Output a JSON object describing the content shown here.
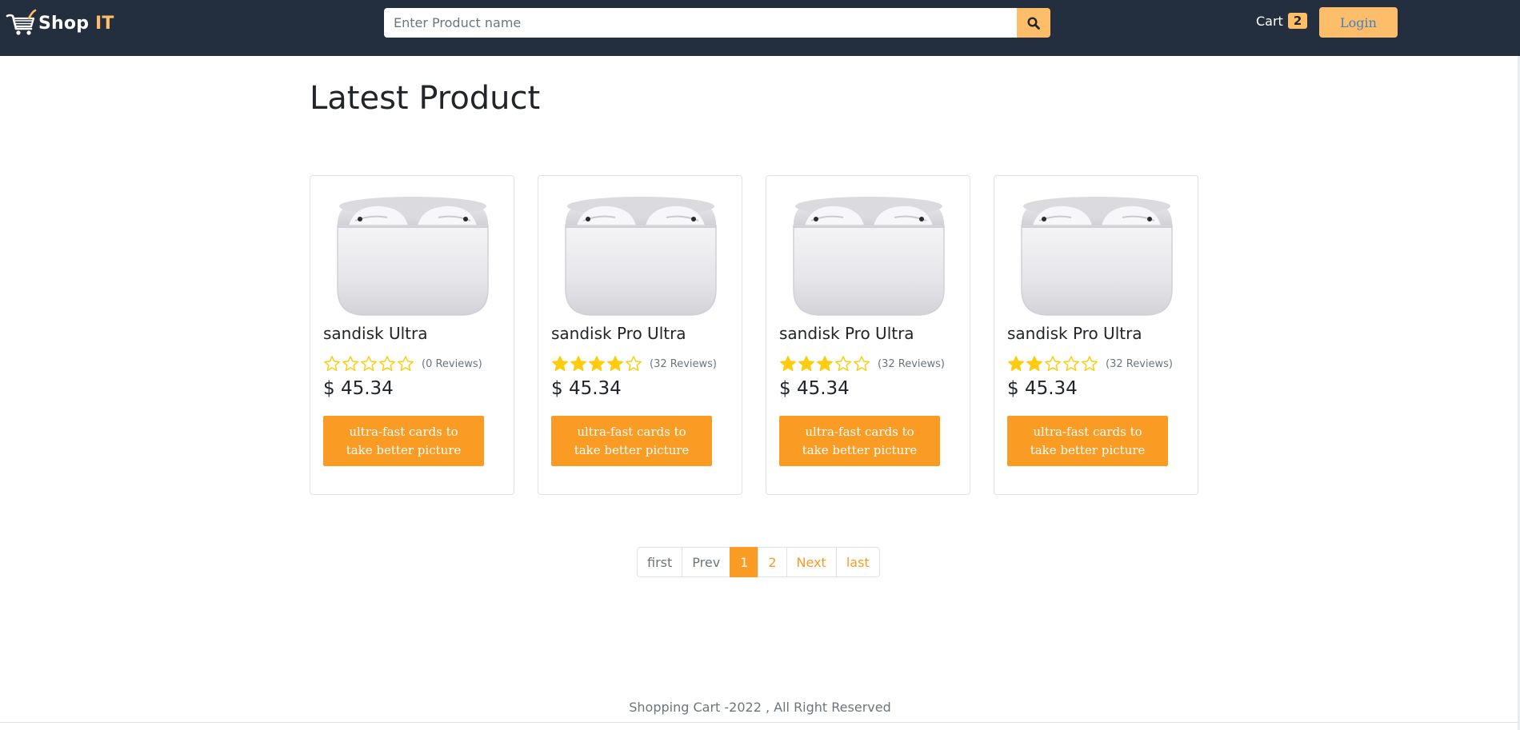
{
  "header": {
    "logo": {
      "brand": "Shop",
      "accent": "IT",
      "icon": "shopping-cart-icon"
    },
    "search": {
      "placeholder": "Enter Product name",
      "value": "",
      "button_icon": "search-icon"
    },
    "cart": {
      "label": "Cart",
      "count": "2"
    },
    "login_label": "Login"
  },
  "main": {
    "title": "Latest Product",
    "products": [
      {
        "name": "sandisk Ultra",
        "rating": 0,
        "reviews": "(0 Reviews)",
        "price": "$ 45.34",
        "button_label": "ultra-fast cards to take better picture"
      },
      {
        "name": "sandisk Pro Ultra",
        "rating": 4,
        "reviews": "(32 Reviews)",
        "price": "$ 45.34",
        "button_label": "ultra-fast cards to take better picture"
      },
      {
        "name": "sandisk Pro Ultra",
        "rating": 3,
        "reviews": "(32 Reviews)",
        "price": "$ 45.34",
        "button_label": "ultra-fast cards to take better picture"
      },
      {
        "name": "sandisk Pro Ultra",
        "rating": 2,
        "reviews": "(32 Reviews)",
        "price": "$ 45.34",
        "button_label": "ultra-fast cards to take better picture"
      }
    ],
    "rating_max": 5
  },
  "pagination": {
    "items": [
      {
        "label": "first",
        "state": "muted"
      },
      {
        "label": "Prev",
        "state": "muted"
      },
      {
        "label": "1",
        "state": "active"
      },
      {
        "label": "2",
        "state": "normal"
      },
      {
        "label": "Next",
        "state": "normal"
      },
      {
        "label": "last",
        "state": "normal"
      }
    ]
  },
  "footer": {
    "text": "Shopping Cart -2022 , All Right Reserved"
  },
  "colors": {
    "navbar": "#232f3e",
    "accent": "#febd69",
    "button_orange": "#fa9c23",
    "star": "#fdcc0d"
  }
}
